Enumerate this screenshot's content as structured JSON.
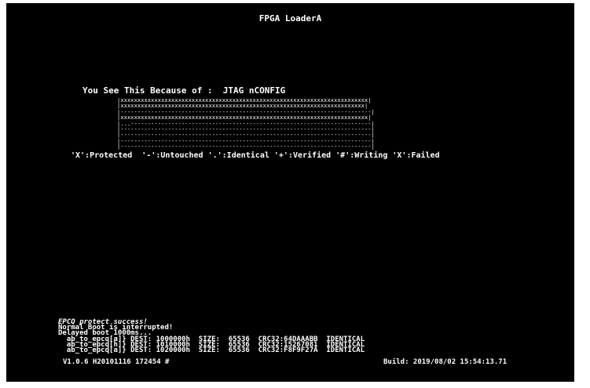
{
  "screen": {
    "title": "FPGA LoaderA",
    "reason": "You See This Because of :  JTAG nCONFIG",
    "flash_map": [
      "|xxxxxxxxxxxxxxxxxxxxxxxxxxxxxxxxxxxxxxxxxxxxxxxxxxxxxxxxxxxxxxxxxxxxxxxxx|",
      "|xxxxxxxxxxxxxxxxxxxxxxxxxxxxxxxxxxxxxxxxxxxxxxxxxxxxxxxxxxxxxxxxxxxxxxxx|",
      "|--------------------------------------------------------------------------|",
      "|xxxxxxxxxxxxxxxxxxxxxxxxxxxxxxxxxxxxxxxxxxxxxxxxxxxxxxxxxxxxxxxxxxxxxxxxx|",
      "|...-----------------------------------------------------------------------|",
      "|--------------------------------------------------------------------------|",
      "|--------------------------------------------------------------------------|",
      "|--------------------------------------------------------------------------|",
      "|--------------------------------------------------------------------------|"
    ],
    "legend": "'X':Protected  '-':Untouched '.':Identical '+':Verified '#':Writing 'X':Failed",
    "log": [
      "EPCQ protect success!",
      "Normal Boot is interrupted!",
      "Delayed boot 1000ms...",
      "  ab_to_epcq[a]} DEST: 1000000h  SIZE:  65536  CRC32:64DAAABB  IDENTICAL",
      "  ab_to_epcq[h]} DEST: 1010000h  SIZE:  65536  CRC32:15267081  IDENTICAL",
      "  ab_to_epcq[a]} DEST: 1020000h  SIZE:  65536  CRC32:F8F9F27A  IDENTICAL"
    ],
    "version": "V1.0.6 H20101116 172454 #",
    "build": "Build: 2019/08/02 15:54:13.71"
  }
}
